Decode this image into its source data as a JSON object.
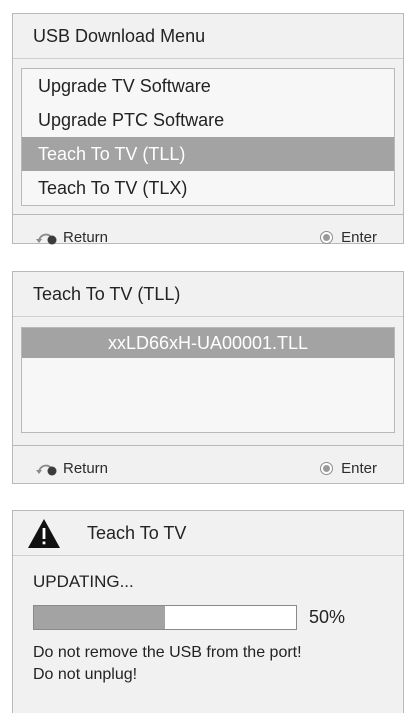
{
  "menu_panel": {
    "title": "USB Download Menu",
    "items": [
      {
        "label": "Upgrade TV Software",
        "selected": false
      },
      {
        "label": "Upgrade PTC Software",
        "selected": false
      },
      {
        "label": "Teach To TV (TLL)",
        "selected": true
      },
      {
        "label": "Teach To TV (TLX)",
        "selected": false
      }
    ],
    "footer": {
      "return_label": "Return",
      "enter_label": "Enter"
    }
  },
  "file_panel": {
    "title": "Teach To TV (TLL)",
    "selected_file": "xxLD66xH-UA00001.TLL",
    "footer": {
      "return_label": "Return",
      "enter_label": "Enter"
    }
  },
  "update_panel": {
    "title": "Teach To TV",
    "status": "UPDATING...",
    "progress_percent": 50,
    "progress_label": "50%",
    "messages": [
      "Do not remove the USB from the port!",
      "Do not unplug!"
    ]
  },
  "colors": {
    "panel_bg": "#f1f1f1",
    "highlight": "#a3a3a3",
    "border": "#b9b9b9"
  },
  "icons": {
    "return": "return-icon",
    "enter": "enter-button-icon",
    "warning": "warning-triangle-icon"
  }
}
